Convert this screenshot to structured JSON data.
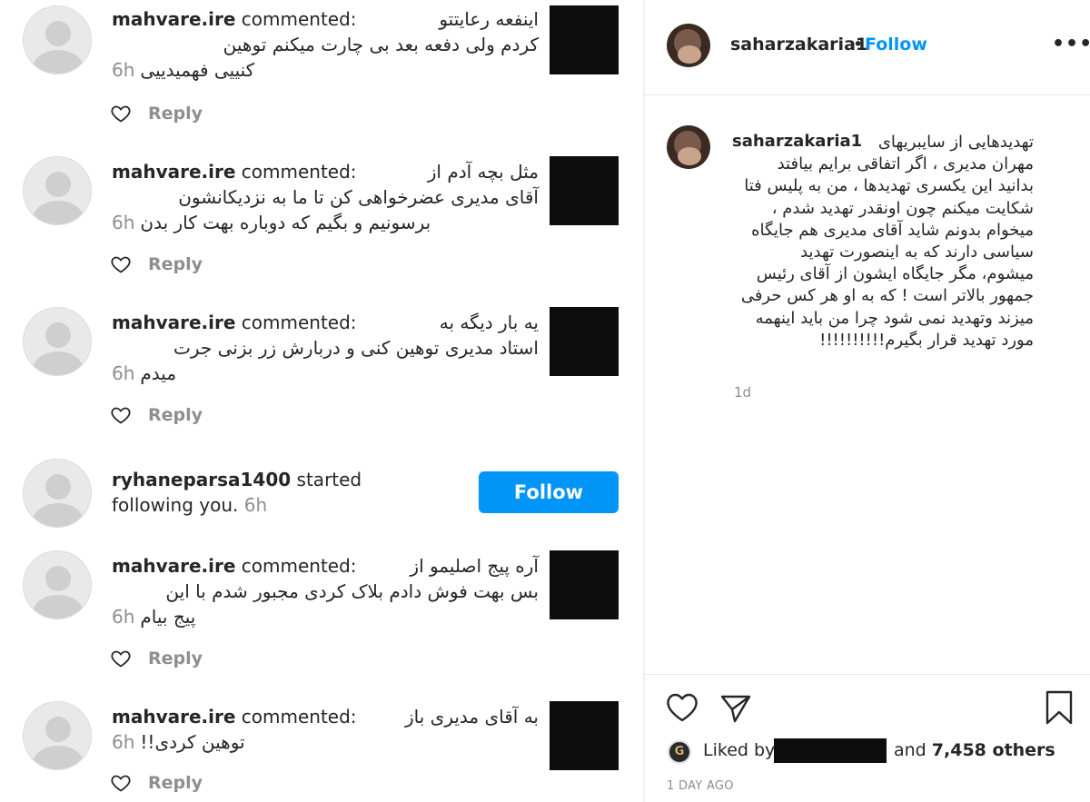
{
  "notifications": [
    {
      "user": "mahvare.ire",
      "verb": "commented:",
      "lines": [
        "اینفعه رعایتتو",
        "کردم ولی دفعه بعد بی چارت میکنم توهین",
        "کنییی فهمیدییی"
      ],
      "time": "6h",
      "reply": "Reply"
    },
    {
      "user": "mahvare.ire",
      "verb": "commented:",
      "lines": [
        "مثل بچه آدم از",
        "آقای مدیری عضرخواهی کن تا ما به نزدیکانشون",
        "برسونیم و بگیم که دوباره بهت کار بدن"
      ],
      "time": "6h",
      "reply": "Reply"
    },
    {
      "user": "mahvare.ire",
      "verb": "commented:",
      "lines": [
        "یه بار دیگه به",
        "استاد مدیری توهین کنی و دربارش زر بزنی جرت",
        "میدم"
      ],
      "time": "6h",
      "reply": "Reply"
    },
    {
      "user": "ryhaneparsa1400",
      "verb": "started",
      "line2": "following you.",
      "time": "6h",
      "button": "Follow"
    },
    {
      "user": "mahvare.ire",
      "verb": "commented:",
      "lines": [
        "آره پیج اصلیمو از",
        "بس بهت فوش دادم بلاک کردی مجبور شدم با این",
        "پیج بیام"
      ],
      "time": "6h",
      "reply": "Reply"
    },
    {
      "user": "mahvare.ire",
      "verb": "commented:",
      "lines": [
        "به آقای مدیری باز",
        "توهین کردی!!"
      ],
      "time": "6h",
      "reply": "Reply"
    }
  ],
  "post": {
    "username": "saharzakaria1",
    "follow_label": "Follow",
    "dot": "•",
    "more": "•••",
    "caption_lines": [
      "تهدیدهایی از سایبریهای",
      "مهران مدیری ، اگر اتفاقی برایم بیافتد",
      "بدانید این یکسری تهدیدها ، من به پلیس فتا",
      "شکایت میکنم چون اونقدر تهدید شدم ،",
      "میخوام بدونم شاید آقای مدیری هم جایگاه",
      "سیاسی دارند که به اینصورت تهدید",
      "میشوم، مگر جایگاه ایشون از آقای رئیس",
      "جمهور بالاتر است ! که به او هر کس حرفی",
      "میزند وتهدید نمی شود چرا من باید اینهمه",
      "مورد تهدید قرار بگیرم!!!!!!!!!!"
    ],
    "age": "1d",
    "liked_by_label": "Liked by",
    "and_label": "and",
    "others_count": "7,458 others",
    "date": "1 DAY AGO",
    "liker_avatar_letter": "G"
  },
  "colors": {
    "accent": "#0095f6",
    "muted": "#8e8e8e",
    "text": "#262626",
    "redaction": "#0d0d0d"
  }
}
